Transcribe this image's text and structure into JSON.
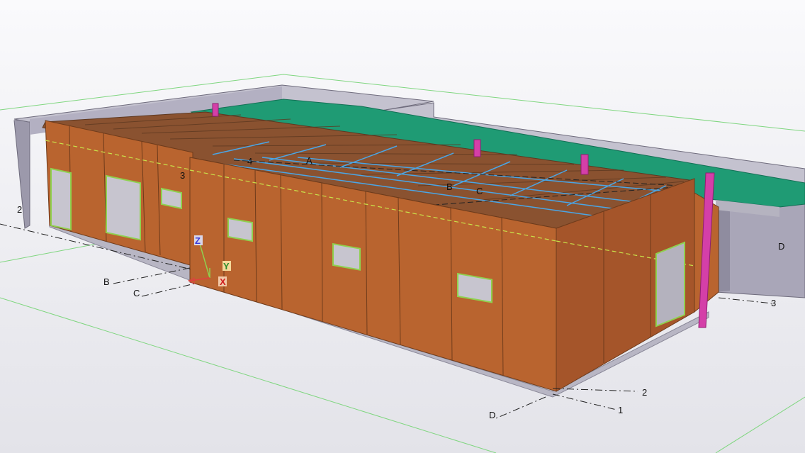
{
  "viewport": {
    "background_top": "#fafafc",
    "background_bottom": "#e3e3e9"
  },
  "grid_labels": {
    "left_2": "2",
    "left_3": "3",
    "left_4": "4",
    "left_B": "B",
    "left_C": "C",
    "roof_A": "A",
    "roof_B": "B",
    "roof_C": "C",
    "right_D": "D",
    "right_3": "3",
    "front_2": "2",
    "front_1": "1",
    "front_D": "D"
  },
  "axis_triad": {
    "z_label": "Z",
    "y_label": "Y",
    "x_label": "X"
  },
  "colors": {
    "wall_panel": "#b9642f",
    "wall_panel_dark": "#a5552a",
    "roof_deck": "#8a5230",
    "roof_grid": "#4aa6e6",
    "green_roof": "#1f9b74",
    "retaining_wall": "#a9a6b8",
    "retaining_wall_top": "#c4c2cf",
    "column_magenta": "#d43fa8",
    "gridline_dash": "#222222",
    "guide_green": "#7fd67f"
  }
}
